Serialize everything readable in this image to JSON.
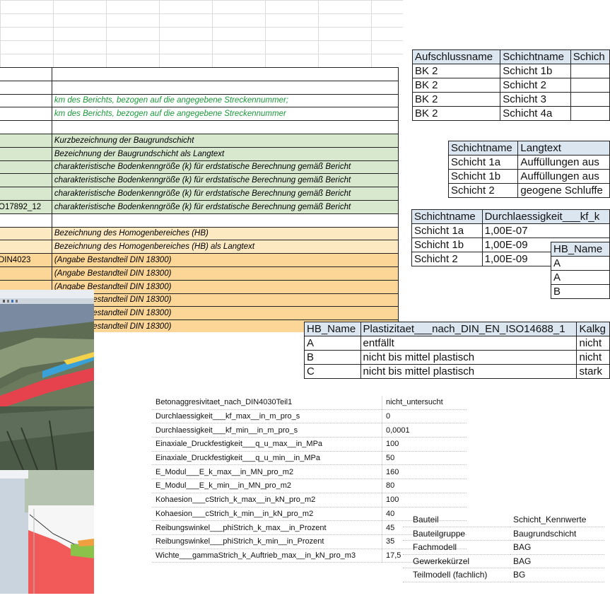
{
  "sheet": {
    "rows": [
      {
        "a": "",
        "b": "",
        "style": "white"
      },
      {
        "a": "",
        "b": "",
        "style": "white"
      },
      {
        "a": "",
        "b": "km des Berichts, bezogen auf die angegebene Streckennummer;",
        "style": "white-green"
      },
      {
        "a": "",
        "b": "km des Berichts, bezogen auf die angegebene Streckennummer",
        "style": "white-green"
      },
      {
        "a": "",
        "b": "",
        "style": "white"
      },
      {
        "a": "",
        "b": "Kurzbezeichnung der Baugrundschicht",
        "style": "green"
      },
      {
        "a": "",
        "b": "Bezeichnung der Baugrundschicht als Langtext",
        "style": "green"
      },
      {
        "a": "",
        "b": "charakteristische Bodenkenngröße (k) für erdstatische Berechnung gemäß Bericht",
        "style": "green"
      },
      {
        "a": "",
        "b": "charakteristische Bodenkenngröße (k) für erdstatische Berechnung gemäß Bericht",
        "style": "green"
      },
      {
        "a": "",
        "b": "charakteristische Bodenkenngröße (k) für erdstatische Berechnung gemäß Bericht",
        "style": "green"
      },
      {
        "a": "O17892_12",
        "b": "charakteristische Bodenkenngröße (k) für erdstatische Berechnung gemäß Bericht",
        "style": "green"
      },
      {
        "a": "",
        "b": "",
        "style": "white"
      },
      {
        "a": "",
        "b": "Bezeichnung des Homogenbereiches (HB)",
        "style": "yellow"
      },
      {
        "a": "",
        "b": "Bezeichnung des Homogenbereiches (HB) als Langtext",
        "style": "yellow"
      },
      {
        "a": "DIN4023",
        "b": "(Angabe Bestandteil DIN 18300)",
        "style": "orange"
      },
      {
        "a": "",
        "b": "(Angabe Bestandteil DIN 18300)",
        "style": "orange"
      },
      {
        "a": "",
        "b": "(Angabe Bestandteil DIN 18300)",
        "style": "orange"
      },
      {
        "a": "",
        "b": "(Angabe Bestandteil DIN 18300)",
        "style": "orange"
      },
      {
        "a": "",
        "b": "(Angabe Bestandteil DIN 18300)",
        "style": "orange"
      },
      {
        "a": "",
        "b": "(Angabe Bestandteil DIN 18300)",
        "style": "orange"
      }
    ]
  },
  "aufschluss": {
    "headers": [
      "Aufschlussname",
      "Schichtname",
      "Schich"
    ],
    "rows": [
      [
        "BK 2",
        "Schicht 1b",
        ""
      ],
      [
        "BK 2",
        "Schicht 2",
        ""
      ],
      [
        "BK 2",
        "Schicht 3",
        ""
      ],
      [
        "BK 2",
        "Schicht 4a",
        ""
      ]
    ]
  },
  "langtext": {
    "headers": [
      "Schichtname",
      "Langtext"
    ],
    "rows": [
      [
        "Schicht 1a",
        "Auffüllungen aus"
      ],
      [
        "Schicht 1b",
        "Auffüllungen aus"
      ],
      [
        "Schicht 2",
        "geogene Schluffe"
      ]
    ]
  },
  "durchlaessigkeit": {
    "headers": [
      "Schichtname",
      "Durchlaessigkeit___kf_k"
    ],
    "rows": [
      [
        "Schicht 1a",
        "1,00E-07"
      ],
      [
        "Schicht 1b",
        "1,00E-09"
      ],
      [
        "Schicht 2",
        "1,00E-09"
      ]
    ]
  },
  "hb_small": {
    "headers": [
      "HB_Name"
    ],
    "rows": [
      [
        "A"
      ],
      [
        "A"
      ],
      [
        "B"
      ]
    ]
  },
  "plastizitaet": {
    "headers": [
      "HB_Name",
      "Plastizitaet___nach_DIN_EN_ISO14688_1",
      "Kalkg"
    ],
    "rows": [
      [
        "A",
        "entfällt",
        "nicht"
      ],
      [
        "B",
        "nicht bis mittel plastisch",
        "nicht"
      ],
      [
        "C",
        "nicht bis mittel plastisch",
        "stark"
      ]
    ]
  },
  "properties": [
    {
      "k": "Betonaggresivitaet_nach_DIN4030Teil1",
      "v": "nicht_untersucht"
    },
    {
      "k": "Durchlaessigkeit___kf_max__in_m_pro_s",
      "v": "0"
    },
    {
      "k": "Durchlaessigkeit___kf_min__in_m_pro_s",
      "v": "0,0001"
    },
    {
      "k": "Einaxiale_Druckfestigkeit___q_u_max__in_MPa",
      "v": "100"
    },
    {
      "k": "Einaxiale_Druckfestigkeit___q_u_min__in_MPa",
      "v": "50"
    },
    {
      "k": "E_Modul___E_k_max__in_MN_pro_m2",
      "v": "160"
    },
    {
      "k": "E_Modul___E_k_min__in_MN_pro_m2",
      "v": "80"
    },
    {
      "k": "Kohaesion___cStrich_k_max__in_kN_pro_m2",
      "v": "100"
    },
    {
      "k": "Kohaesion___cStrich_k_min__in_kN_pro_m2",
      "v": "40"
    },
    {
      "k": "Reibungswinkel___phiStrich_k_max__in_Prozent",
      "v": "45"
    },
    {
      "k": "Reibungswinkel___phiStrich_k_min__in_Prozent",
      "v": "35"
    },
    {
      "k": "Wichte___gammaStrich_k_Auftrieb_max__in_kN_pro_m3",
      "v": "17,5"
    }
  ],
  "properties2": [
    {
      "k": "Bauteil",
      "v": "Schicht_Kennwerte"
    },
    {
      "k": "Bauteilgruppe",
      "v": "Baugrundschicht"
    },
    {
      "k": "Fachmodell",
      "v": "BAG"
    },
    {
      "k": "Gewerkekürzel",
      "v": "BAG"
    },
    {
      "k": "Teilmodell (fachlich)",
      "v": "BG"
    }
  ],
  "colors": {
    "green_row": "#d7e8cf",
    "yellow_row": "#fde9c1",
    "orange_row": "#fbd696",
    "header_blue": "#dce6f1",
    "green_text": "#1a9a3a"
  }
}
